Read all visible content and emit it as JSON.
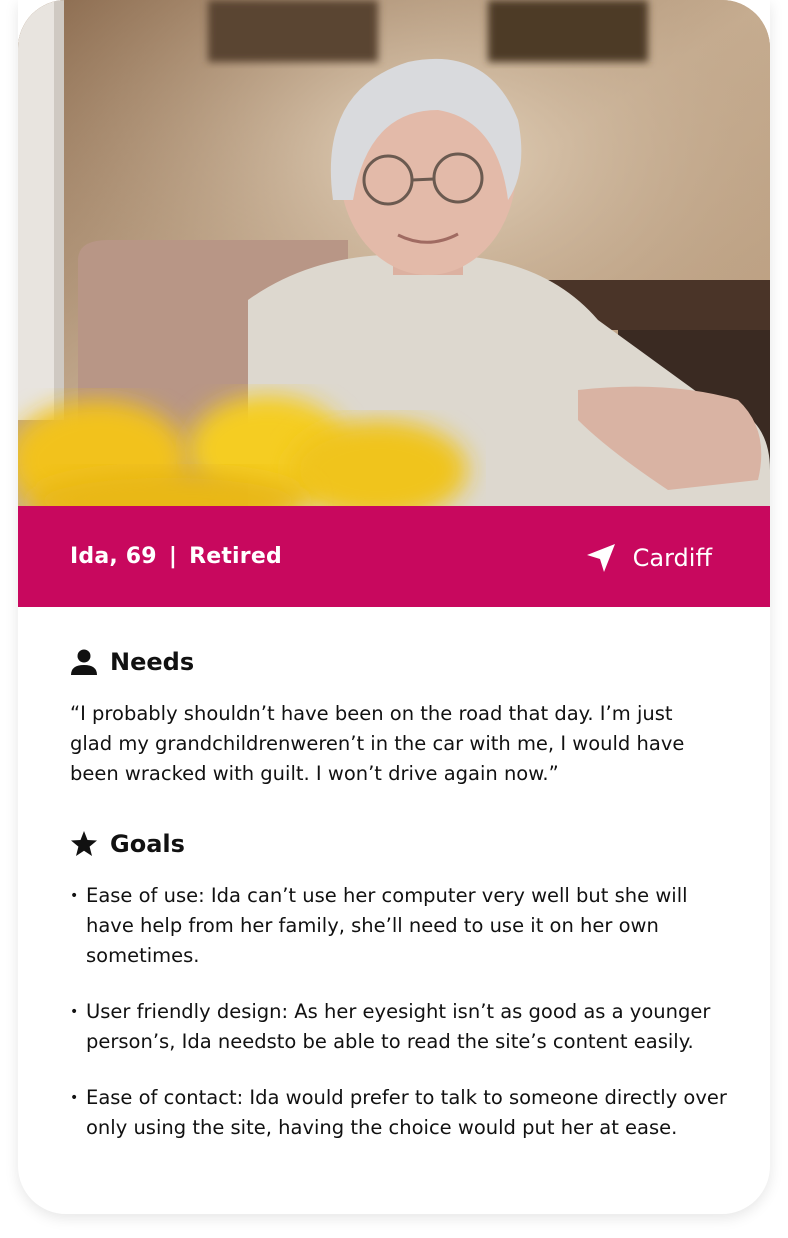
{
  "persona": {
    "name_age": "Ida, 69",
    "separator": "|",
    "occupation": "Retired",
    "location": "Cardiff",
    "location_icon": "navigation-arrow-icon"
  },
  "needs": {
    "icon": "person-icon",
    "title": "Needs",
    "quote": "“I probably shouldn’t have been on the road that day. I’m just glad my grandchildrenweren’t in the car with me, I would have been wracked with guilt. I won’t drive again now.”"
  },
  "goals": {
    "icon": "star-icon",
    "title": "Goals",
    "items": [
      "Ease of use: Ida can’t use her computer very well but she will have help from her family, she’ll need to use it on her own sometimes.",
      "User friendly design: As her eyesight isn’t as good as a younger person’s, Ida needsto be able to read the site’s content easily.",
      "Ease of contact: Ida would prefer to talk to someone directly over only using the site, having the choice would put her at ease."
    ]
  },
  "colors": {
    "banner": "#c8085e",
    "text": "#111111",
    "background": "#ffffff"
  }
}
